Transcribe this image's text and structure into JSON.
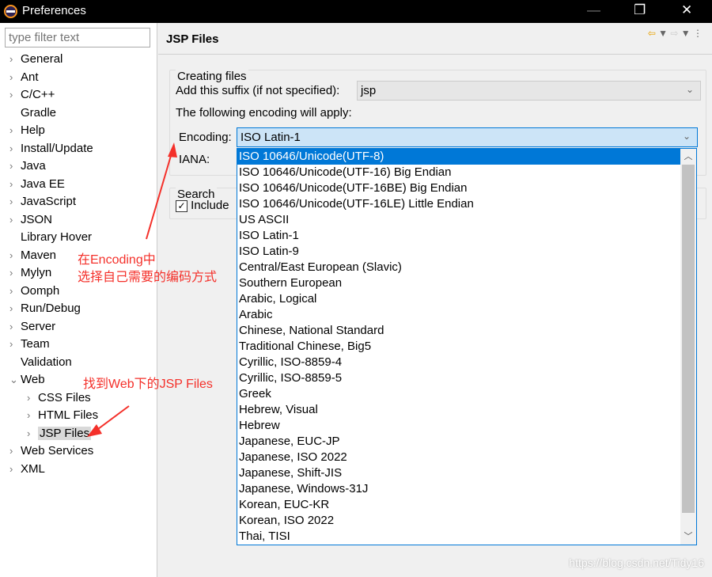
{
  "window": {
    "title": "Preferences"
  },
  "sidebar": {
    "filter_placeholder": "type filter text",
    "items": [
      {
        "label": "General",
        "chev": "›"
      },
      {
        "label": "Ant",
        "chev": "›"
      },
      {
        "label": "C/C++",
        "chev": "›"
      },
      {
        "label": "Gradle",
        "chev": ""
      },
      {
        "label": "Help",
        "chev": "›"
      },
      {
        "label": "Install/Update",
        "chev": "›"
      },
      {
        "label": "Java",
        "chev": "›"
      },
      {
        "label": "Java EE",
        "chev": "›"
      },
      {
        "label": "JavaScript",
        "chev": "›"
      },
      {
        "label": "JSON",
        "chev": "›"
      },
      {
        "label": "Library Hover",
        "chev": ""
      },
      {
        "label": "Maven",
        "chev": "›"
      },
      {
        "label": "Mylyn",
        "chev": "›"
      },
      {
        "label": "Oomph",
        "chev": "›"
      },
      {
        "label": "Run/Debug",
        "chev": "›"
      },
      {
        "label": "Server",
        "chev": "›"
      },
      {
        "label": "Team",
        "chev": "›"
      },
      {
        "label": "Validation",
        "chev": ""
      },
      {
        "label": "Web",
        "chev": "⌄"
      },
      {
        "label": "CSS Files",
        "chev": "›",
        "child": true
      },
      {
        "label": "HTML Files",
        "chev": "›",
        "child": true
      },
      {
        "label": "JSP Files",
        "chev": "›",
        "child": true,
        "selected": true
      },
      {
        "label": "Web Services",
        "chev": "›"
      },
      {
        "label": "XML",
        "chev": "›"
      }
    ]
  },
  "page": {
    "title": "JSP Files",
    "creating_files": {
      "label": "Creating files",
      "suffix_label": "Add this suffix (if not specified):",
      "suffix_value": "jsp",
      "encoding_note": "The following encoding will apply:",
      "encoding_label": "Encoding:",
      "encoding_value": "ISO Latin-1",
      "iana_label": "IANA:"
    },
    "search": {
      "label": "Search",
      "include_label": "Include",
      "include_checked": true
    }
  },
  "encoding_options": [
    "ISO 10646/Unicode(UTF-8)",
    "ISO 10646/Unicode(UTF-16) Big Endian",
    "ISO 10646/Unicode(UTF-16BE) Big Endian",
    "ISO 10646/Unicode(UTF-16LE) Little Endian",
    "US ASCII",
    "ISO Latin-1",
    "ISO Latin-9",
    "Central/East European (Slavic)",
    "Southern European",
    "Arabic, Logical",
    "Arabic",
    "Chinese, National Standard",
    "Traditional Chinese, Big5",
    "Cyrillic, ISO-8859-4",
    "Cyrillic, ISO-8859-5",
    "Greek",
    "Hebrew, Visual",
    "Hebrew",
    "Japanese, EUC-JP",
    "Japanese, ISO 2022",
    "Japanese, Shift-JIS",
    "Japanese, Windows-31J",
    "Korean, EUC-KR",
    "Korean, ISO 2022",
    "Thai, TISI"
  ],
  "highlighted_option": 0,
  "annotations": {
    "encoding_line1": "在Encoding中",
    "encoding_line2": "选择自己需要的编码方式",
    "web_note": "找到Web下的JSP Files",
    "color": "#f4302a"
  },
  "watermark": "https://blog.csdn.net/Tidy16"
}
